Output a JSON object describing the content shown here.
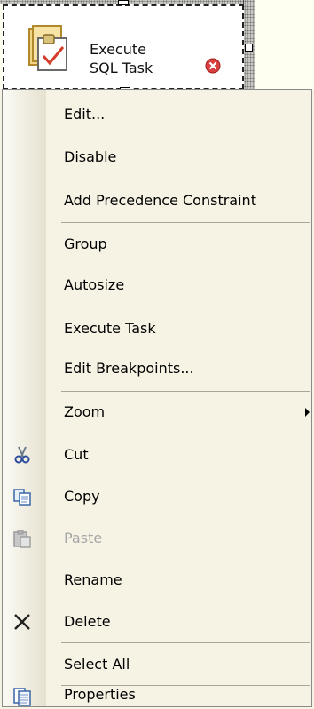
{
  "task": {
    "title_line1": "Execute",
    "title_line2": "SQL Task",
    "icon": "sql-task-icon",
    "status_icon": "error-icon",
    "status_color": "#d94040"
  },
  "menu": {
    "items": [
      {
        "label": "Edit...",
        "icon": null,
        "enabled": true
      },
      {
        "label": "Disable",
        "icon": null,
        "enabled": true
      },
      {
        "label": "Add Precedence Constraint",
        "icon": null,
        "enabled": true
      },
      {
        "label": "Group",
        "icon": null,
        "enabled": true
      },
      {
        "label": "Autosize",
        "icon": null,
        "enabled": true
      },
      {
        "label": "Execute Task",
        "icon": null,
        "enabled": true
      },
      {
        "label": "Edit Breakpoints...",
        "icon": null,
        "enabled": true
      },
      {
        "label": "Zoom",
        "icon": null,
        "enabled": true,
        "submenu": true
      },
      {
        "label": "Cut",
        "icon": "scissors-icon",
        "enabled": true
      },
      {
        "label": "Copy",
        "icon": "copy-icon",
        "enabled": true
      },
      {
        "label": "Paste",
        "icon": "paste-icon",
        "enabled": false
      },
      {
        "label": "Rename",
        "icon": null,
        "enabled": true
      },
      {
        "label": "Delete",
        "icon": "delete-x-icon",
        "enabled": true
      },
      {
        "label": "Select All",
        "icon": null,
        "enabled": true
      },
      {
        "label": "Properties",
        "icon": "properties-icon",
        "enabled": true
      }
    ]
  },
  "colors": {
    "menu_background": "#f6f3e4",
    "separator": "#a8a59a",
    "disabled_text": "#a7a7a7"
  }
}
